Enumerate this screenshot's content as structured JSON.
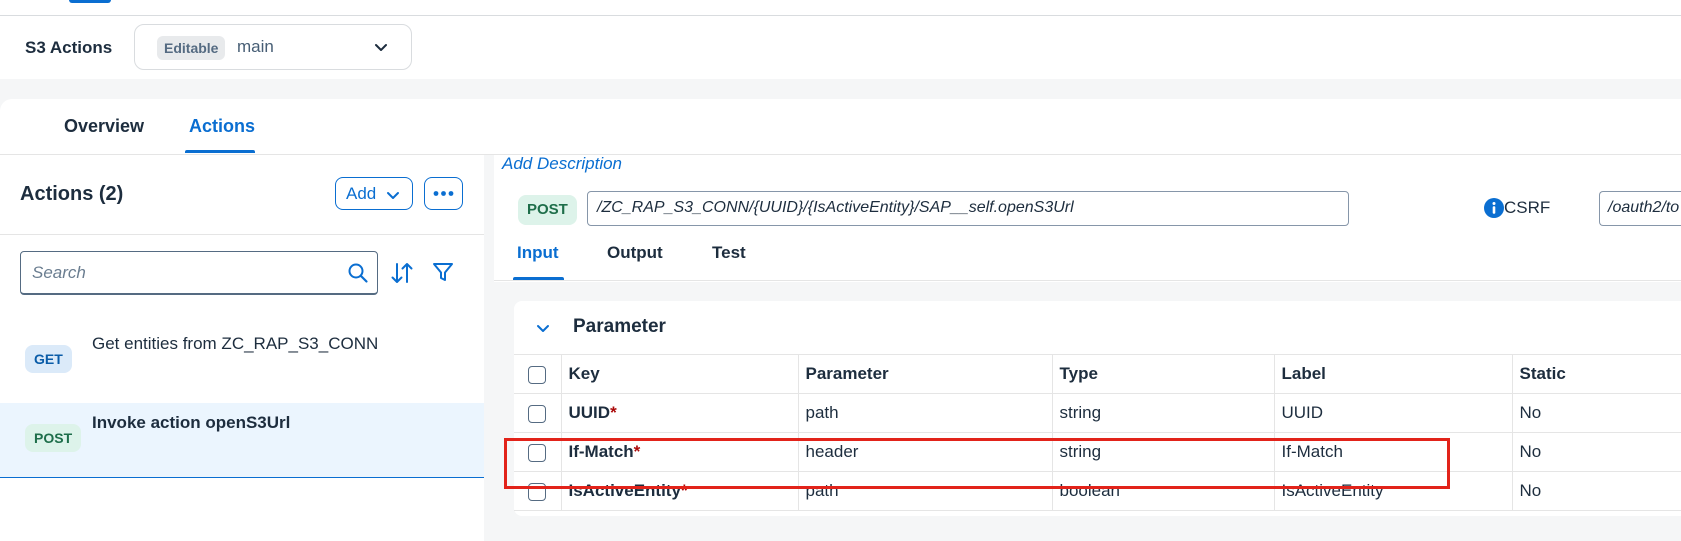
{
  "header": {
    "title": "S3 Actions",
    "branch_badge": "Editable",
    "branch_name": "main",
    "chevron_icon": "chevron-down-icon"
  },
  "tabs": [
    {
      "label": "Overview",
      "selected": false
    },
    {
      "label": "Actions",
      "selected": true
    }
  ],
  "left_panel": {
    "title": "Actions (2)",
    "add_label": "Add",
    "search_placeholder": "Search",
    "search_value": "",
    "icons": [
      "chevron-down-icon",
      "more-icon",
      "search-icon",
      "sort-icon",
      "filter-icon"
    ],
    "items": [
      {
        "method": "GET",
        "label": "Get entities from ZC_RAP_S3_CONN",
        "selected": false
      },
      {
        "method": "POST",
        "label": "Invoke action openS3Url",
        "selected": true
      }
    ]
  },
  "right_panel": {
    "add_description": "Add Description",
    "method": "POST",
    "url": "/ZC_RAP_S3_CONN/{UUID}/{IsActiveEntity}/SAP__self.openS3Url",
    "csrf_label": "CSRF",
    "csrf_icon": "info-icon",
    "token_url": "/oauth2/to",
    "sub_tabs": [
      {
        "label": "Input",
        "selected": true
      },
      {
        "label": "Output",
        "selected": false
      },
      {
        "label": "Test",
        "selected": false
      }
    ],
    "parameter_section": {
      "title": "Parameter",
      "columns": [
        "Key",
        "Parameter",
        "Type",
        "Label",
        "Static"
      ],
      "rows": [
        {
          "key": "UUID",
          "required": "*",
          "parameter": "path",
          "type": "string",
          "label": "UUID",
          "static": "No"
        },
        {
          "key": "If-Match",
          "required": "*",
          "parameter": "header",
          "type": "string",
          "label": "If-Match",
          "static": "No",
          "highlighted": true
        },
        {
          "key": "IsActiveEntity",
          "required": "*",
          "parameter": "path",
          "type": "boolean",
          "label": "IsActiveEntity",
          "static": "No"
        }
      ]
    }
  },
  "colors": {
    "accent": "#0a6ed1",
    "highlight_box": "#e2231a",
    "required_mark": "#aa0808"
  }
}
